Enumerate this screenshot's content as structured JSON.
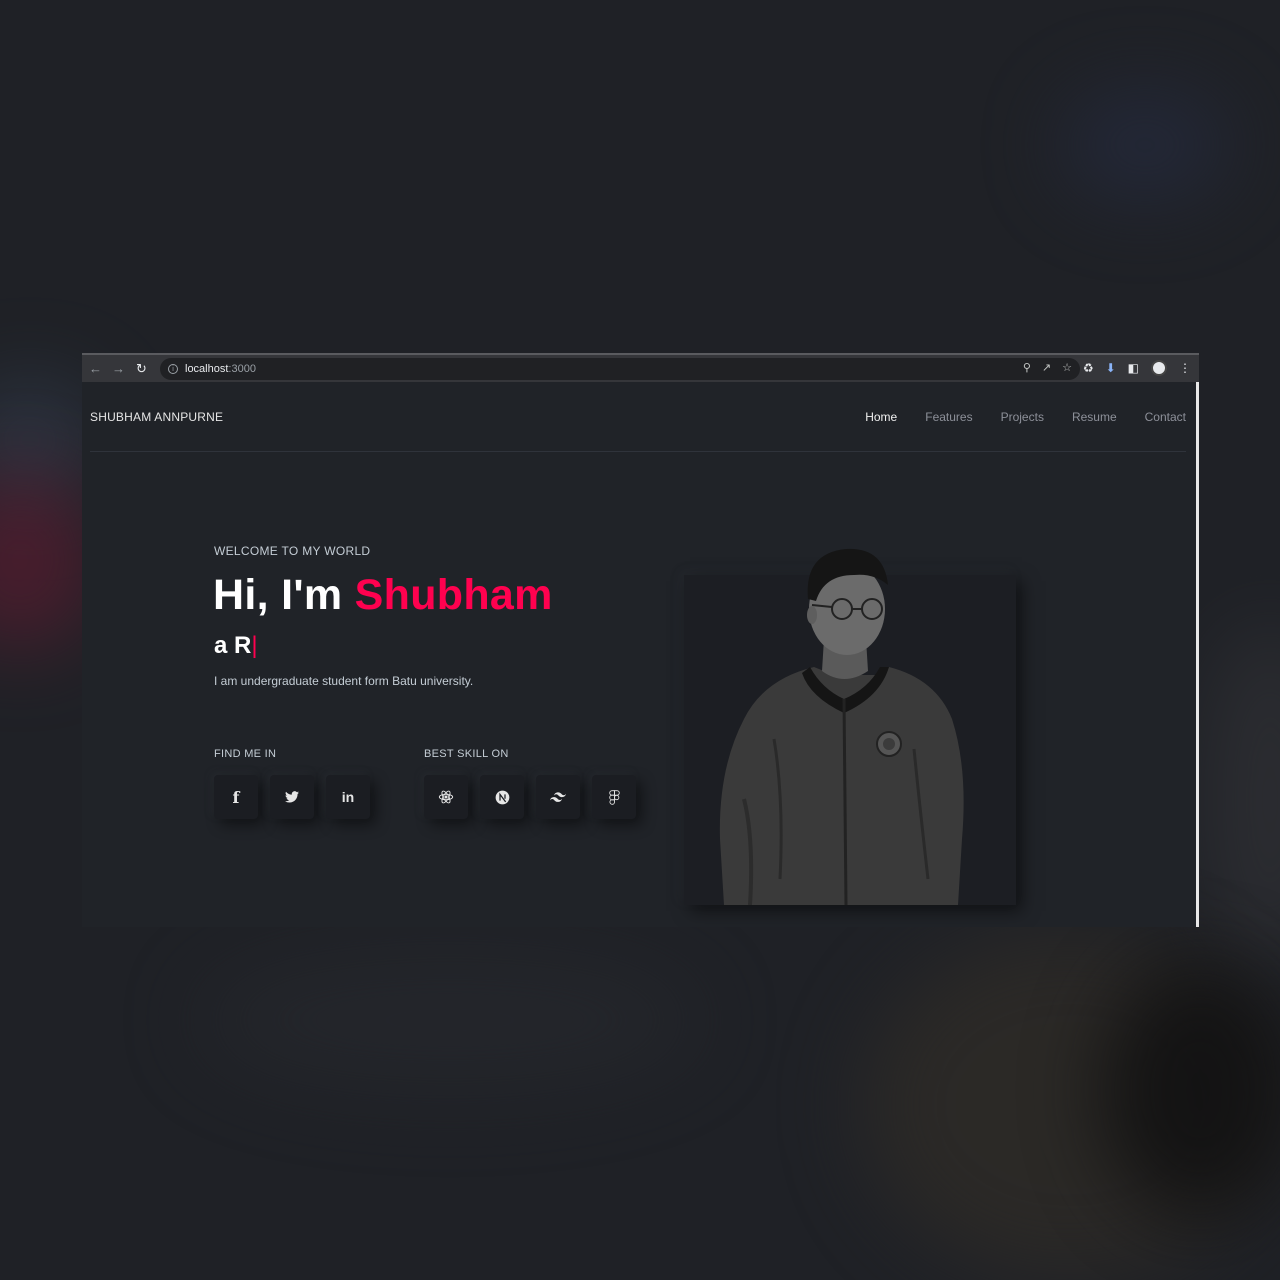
{
  "browser": {
    "url_host": "localhost",
    "url_port": ":3000",
    "icons": [
      "back-icon",
      "forward-icon",
      "reload-icon",
      "info-icon",
      "zoom-icon",
      "share-icon",
      "star-icon",
      "extensions-icon",
      "download-icon",
      "sidepanel-icon",
      "profile-avatar",
      "menu-icon"
    ]
  },
  "header": {
    "brand": "SHUBHAM ANNPURNE",
    "nav": [
      {
        "label": "Home",
        "active": true
      },
      {
        "label": "Features",
        "active": false
      },
      {
        "label": "Projects",
        "active": false
      },
      {
        "label": "Resume",
        "active": false
      },
      {
        "label": "Contact",
        "active": false
      }
    ]
  },
  "hero": {
    "welcome": "WELCOME TO MY WORLD",
    "greeting": "Hi, I'm ",
    "name": "Shubham",
    "typed": "a R",
    "cursor": "|",
    "bio": "I am undergraduate student form Batu university."
  },
  "social": {
    "title": "FIND ME IN",
    "icons": [
      "facebook-icon",
      "twitter-icon",
      "linkedin-icon"
    ]
  },
  "skills": {
    "title": "BEST SKILL ON",
    "icons": [
      "react-icon",
      "nextjs-icon",
      "tailwind-icon",
      "figma-icon"
    ]
  },
  "colors": {
    "accent": "#ff014f",
    "background": "#202328",
    "text_muted": "#c4cdd5"
  }
}
